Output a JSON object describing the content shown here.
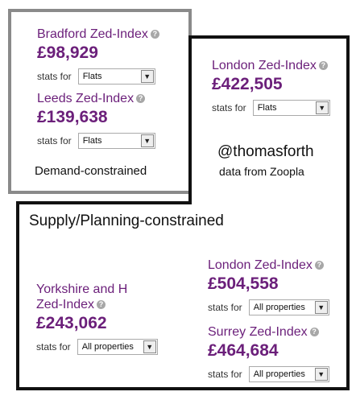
{
  "demand": {
    "label": "Demand-constrained",
    "bradford": {
      "title": "Bradford Zed-Index",
      "value": "£98,929",
      "stats_label": "stats for",
      "select_value": "Flats"
    },
    "leeds": {
      "title": "Leeds Zed-Index",
      "value": "£139,638",
      "stats_label": "stats for",
      "select_value": "Flats"
    }
  },
  "supply": {
    "label": "Supply/Planning-constrained",
    "london_flats": {
      "title": "London Zed-Index",
      "value": "£422,505",
      "stats_label": "stats for",
      "select_value": "Flats"
    },
    "london_all": {
      "title": "London Zed-Index",
      "value": "£504,558",
      "stats_label": "stats for",
      "select_value": "All properties"
    },
    "yorkshire": {
      "title_line1": "Yorkshire and  H",
      "title_line2": "Zed-Index",
      "value": "£243,062",
      "stats_label": "stats for",
      "select_value": "All properties"
    },
    "surrey": {
      "title": "Surrey Zed-Index",
      "value": "£464,684",
      "stats_label": "stats for",
      "select_value": "All properties"
    }
  },
  "credit": {
    "handle": "@thomasforth",
    "source": "data from Zoopla"
  },
  "icons": {
    "help": "help-icon",
    "dropdown": "chevron-down-icon"
  },
  "colors": {
    "accent": "#6b1f7a",
    "demand_border": "#8a8a8a",
    "supply_border": "#111111"
  }
}
